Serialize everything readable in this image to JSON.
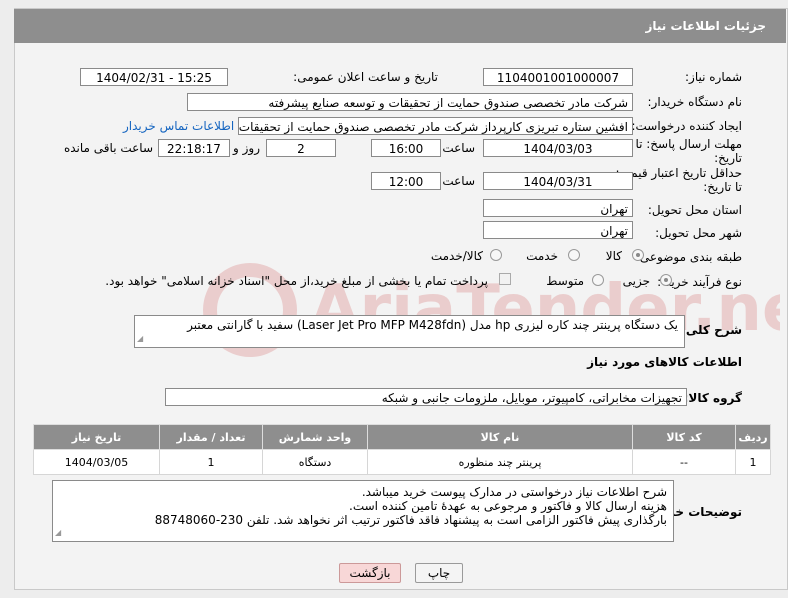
{
  "header": {
    "title": "جزئیات اطلاعات نیاز"
  },
  "watermark": {
    "text": "AriaTender.neT"
  },
  "fields": {
    "need_number_label": "شماره نیاز:",
    "need_number_value": "1104001001000007",
    "announce_label": "تاریخ و ساعت اعلان عمومی:",
    "announce_value": "1404/02/31 - 15:25",
    "buyer_org_label": "نام دستگاه خریدار:",
    "buyer_org_value": "شرکت مادر تخصصی صندوق حمایت از تحقیقات و توسعه صنایع پیشرفته",
    "requester_label": "ایجاد کننده درخواست:",
    "requester_value": "افشین  ستاره تبریزی کارپرداز شرکت مادر تخصصی صندوق حمایت از تحقیقات و توسعه صنایع پیشرفته",
    "buyer_contact_link": "اطلاعات تماس خریدار",
    "reply_deadline_label": "مهلت ارسال پاسخ: تا تاریخ:",
    "reply_date": "1404/03/03",
    "time_label": "ساعت",
    "reply_time": "16:00",
    "days_value": "2",
    "days_label": "روز و",
    "remaining_time": "22:18:17",
    "remaining_label": "ساعت باقی مانده",
    "price_validity_label": "حداقل تاریخ اعتبار قیمت: تا تاریخ:",
    "price_date": "1404/03/31",
    "price_time_label": "ساعت",
    "price_time": "12:00",
    "province_label": "استان محل تحویل:",
    "province_value": "تهران",
    "city_label": "شهر محل تحویل:",
    "city_value": "تهران",
    "category_label": "طبقه بندی موضوعی:",
    "category_options": [
      "کالا",
      "خدمت",
      "کالا/خدمت"
    ],
    "process_label": "نوع فرآیند خرید :",
    "process_options": [
      "جزیی",
      "متوسط"
    ],
    "payment_note": "پرداخت تمام یا بخشی از مبلغ خرید،از محل \"اسناد خزانه اسلامی\" خواهد بود.",
    "description_label": "شرح کلی نیاز:",
    "description_value": "یک دستگاه پرینتر چند کاره لیزری hp مدل (Laser Jet Pro MFP M428fdn) سفید با گارانتی معتبر",
    "goods_info_title": "اطلاعات کالاهای مورد نیاز",
    "goods_group_label": "گروه کالا:",
    "goods_group_value": "تجهیزات مخابراتی، کامپیوتر، موبایل، ملزومات جانبی و شبکه",
    "buyer_notes_label": "توضیحات خریدار:",
    "buyer_notes_lines": [
      "شرح اطلاعات نیاز درخواستی در مدارک پیوست خرید میباشد.",
      "هزینه ارسال کالا و فاکتور و مرجوعی به عهدهٔ تامین کننده است.",
      "بارگذاری پیش فاکتور الزامی است به پیشنهاد فاقد فاکتور ترتیب اثر نخواهد شد. تلفن 230-88748060"
    ]
  },
  "table": {
    "headers": [
      "ردیف",
      "کد کالا",
      "نام کالا",
      "واحد شمارش",
      "تعداد / مقدار",
      "تاریخ نیاز"
    ],
    "rows": [
      [
        "1",
        "--",
        "پرینتر چند منظوره",
        "دستگاه",
        "1",
        "1404/03/05"
      ]
    ]
  },
  "buttons": {
    "print": "چاپ",
    "back": "بازگشت"
  }
}
